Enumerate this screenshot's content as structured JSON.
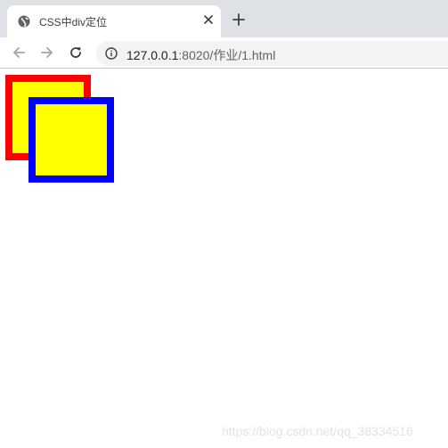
{
  "tab": {
    "title": "CSS中div定位",
    "favicon": "globe-icon",
    "close_icon": "close-icon"
  },
  "toolbar": {
    "new_tab_icon": "plus-icon",
    "back_icon": "arrow-left-icon",
    "forward_icon": "arrow-right-icon",
    "reload_icon": "reload-icon",
    "info_icon": "info-icon",
    "url_host": "127.0.0.1",
    "url_path": ":8020/作业/1.html"
  },
  "content": {
    "box1": {
      "border_color": "#ff0000",
      "fill_color": "#ffff00"
    },
    "box2": {
      "border_color": "#0000ff",
      "fill_color": "#ffff00"
    }
  },
  "watermark": "https://blog.csdn.net/qq_38334516"
}
